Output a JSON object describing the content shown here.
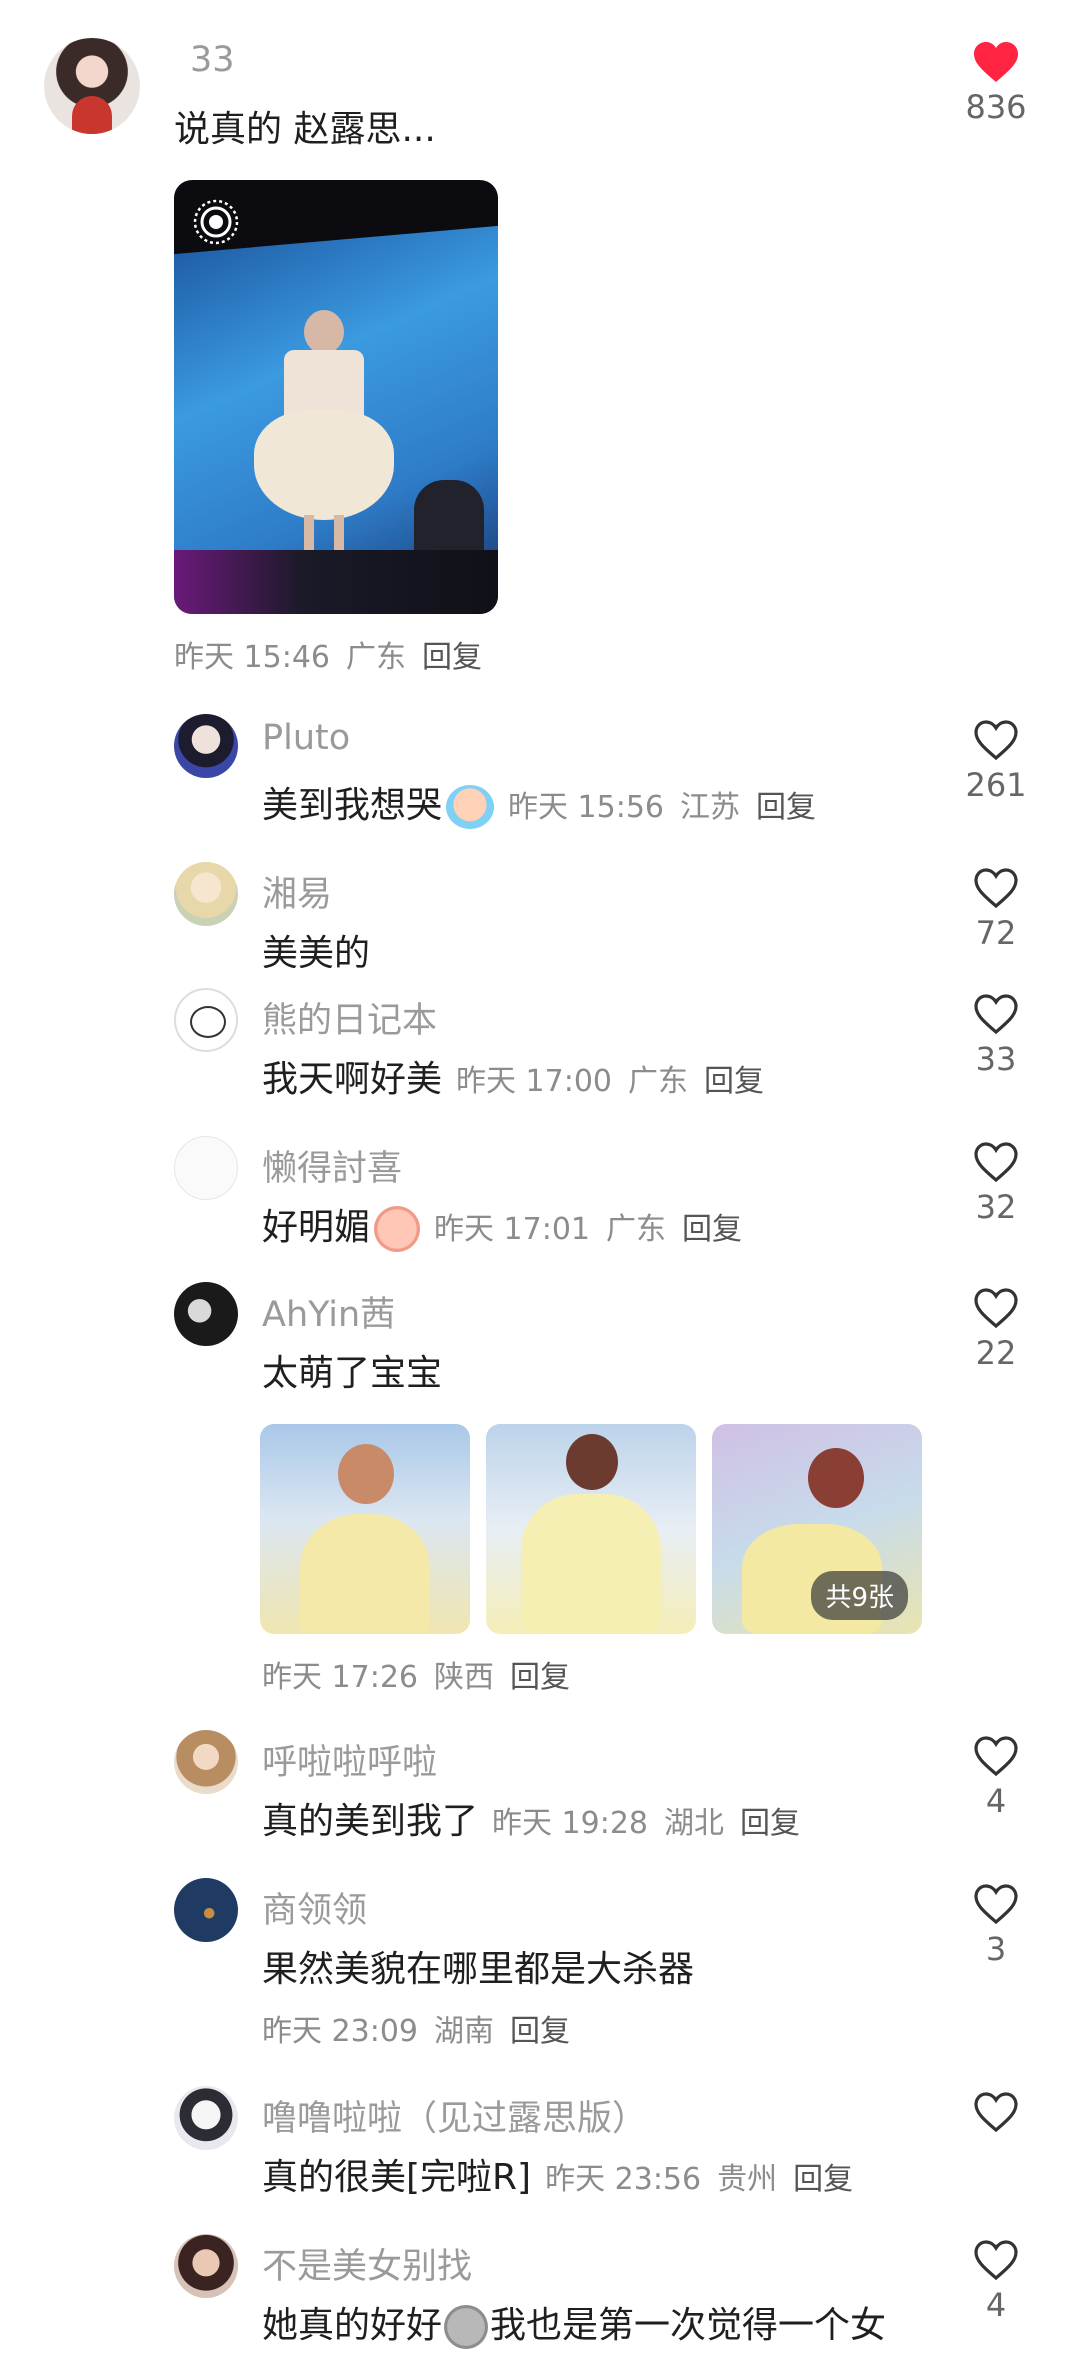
{
  "top_comment": {
    "user": "33",
    "text": "说真的 赵露思...",
    "likes": "836",
    "time": "昨天 15:46",
    "location": "广东",
    "reply": "回复",
    "liked": true
  },
  "comments": [
    {
      "user": "Pluto",
      "text": "美到我想哭",
      "time": "昨天 15:56",
      "location": "江苏",
      "reply": "回复",
      "likes": "261",
      "emoji": "crying-face-icon"
    },
    {
      "user": "湘易",
      "text": "美美的",
      "likes": "72"
    },
    {
      "user": "熊的日记本",
      "text": "我天啊好美",
      "time": "昨天 17:00",
      "location": "广东",
      "reply": "回复",
      "likes": "33"
    },
    {
      "user": "懒得討喜",
      "text": "好明媚",
      "time": "昨天 17:01",
      "location": "广东",
      "reply": "回复",
      "likes": "32",
      "emoji": "shy-face-icon"
    },
    {
      "user": "AhYin茜",
      "text": "太萌了宝宝",
      "likes": "22",
      "time": "昨天 17:26",
      "location": "陕西",
      "reply": "回复",
      "images_badge": "共9张"
    },
    {
      "user": "呼啦啦呼啦",
      "text": "真的美到我了",
      "time": "昨天 19:28",
      "location": "湖北",
      "reply": "回复",
      "likes": "4"
    },
    {
      "user": "商领领",
      "text": "果然美貌在哪里都是大杀器",
      "likes": "3",
      "time": "昨天 23:09",
      "location": "湖南",
      "reply": "回复"
    },
    {
      "user": "噜噜啦啦（见过露思版）",
      "text": "真的很美[完啦R]",
      "time": "昨天 23:56",
      "location": "贵州",
      "reply": "回复",
      "likes": ""
    },
    {
      "user": "不是美女别找",
      "text_a": "她真的好好",
      "text_b": "我也是第一次觉得一个女",
      "likes": "4",
      "emoji": "grey-face-icon"
    }
  ],
  "colors": {
    "accent": "#ff2442",
    "name": "#9a9a9a",
    "meta": "#8c8c8c"
  }
}
